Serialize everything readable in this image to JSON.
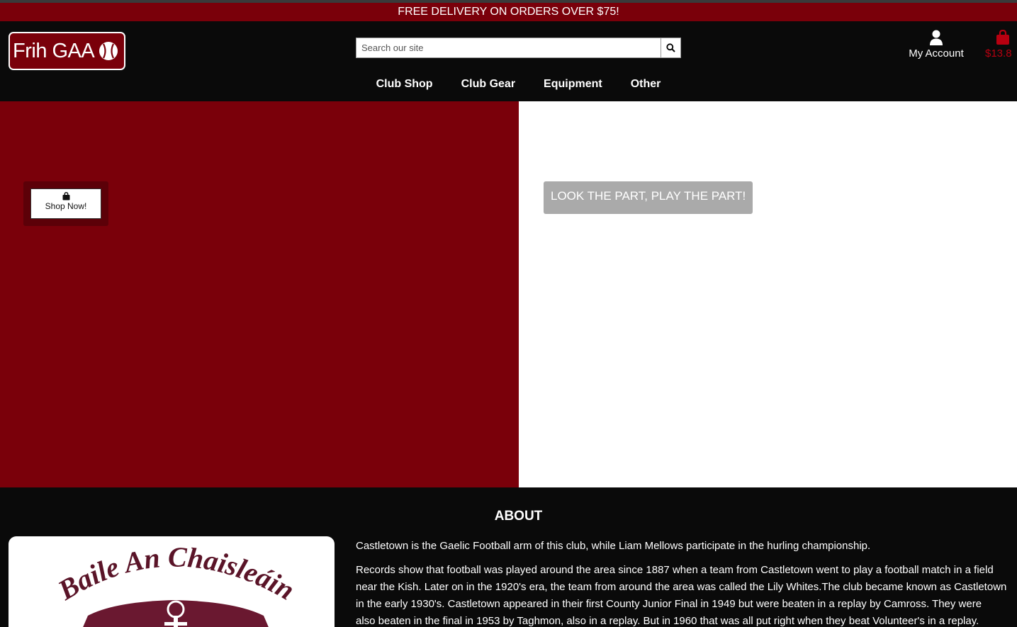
{
  "promo": {
    "text": "FREE DELIVERY ON ORDERS OVER $75!"
  },
  "header": {
    "logo_text": "Frih GAA",
    "search": {
      "placeholder": "Search our site"
    },
    "account_label": "My Account",
    "bag_total": "$13.8"
  },
  "nav": {
    "items": [
      {
        "label": "Club Shop"
      },
      {
        "label": "Club Gear"
      },
      {
        "label": "Equipment"
      },
      {
        "label": "Other"
      }
    ]
  },
  "hero": {
    "shop_button": "Shop Now!",
    "tagline": "LOOK THE PART, PLAY THE PART!"
  },
  "about": {
    "title": "ABOUT",
    "crest_text": "Baile An Chaisleáin",
    "lines": [
      "Castletown is the Gaelic Football arm of this club, while Liam Mellows participate in the hurling championship.",
      "Records show that football was played around the area since 1887 when a team from Castletown went to play a football match in a field",
      "near the Kish. Later on in the 1920's era, the team from around the area was called the Lily Whites.The club became known as Castletown",
      "in the early 1930's. Castletown appeared in their first County Junior Final in 1949 but were beaten in a replay by Camross. They were",
      "also beaten in the final in 1953 by Taghmon, also in a replay. But in 1960 that was all put right when they beat Volunteer's in a replay."
    ]
  },
  "colors": {
    "brand_red": "#7a000a",
    "bag_red": "#b80010",
    "tag_grey": "#aaaaaa"
  }
}
